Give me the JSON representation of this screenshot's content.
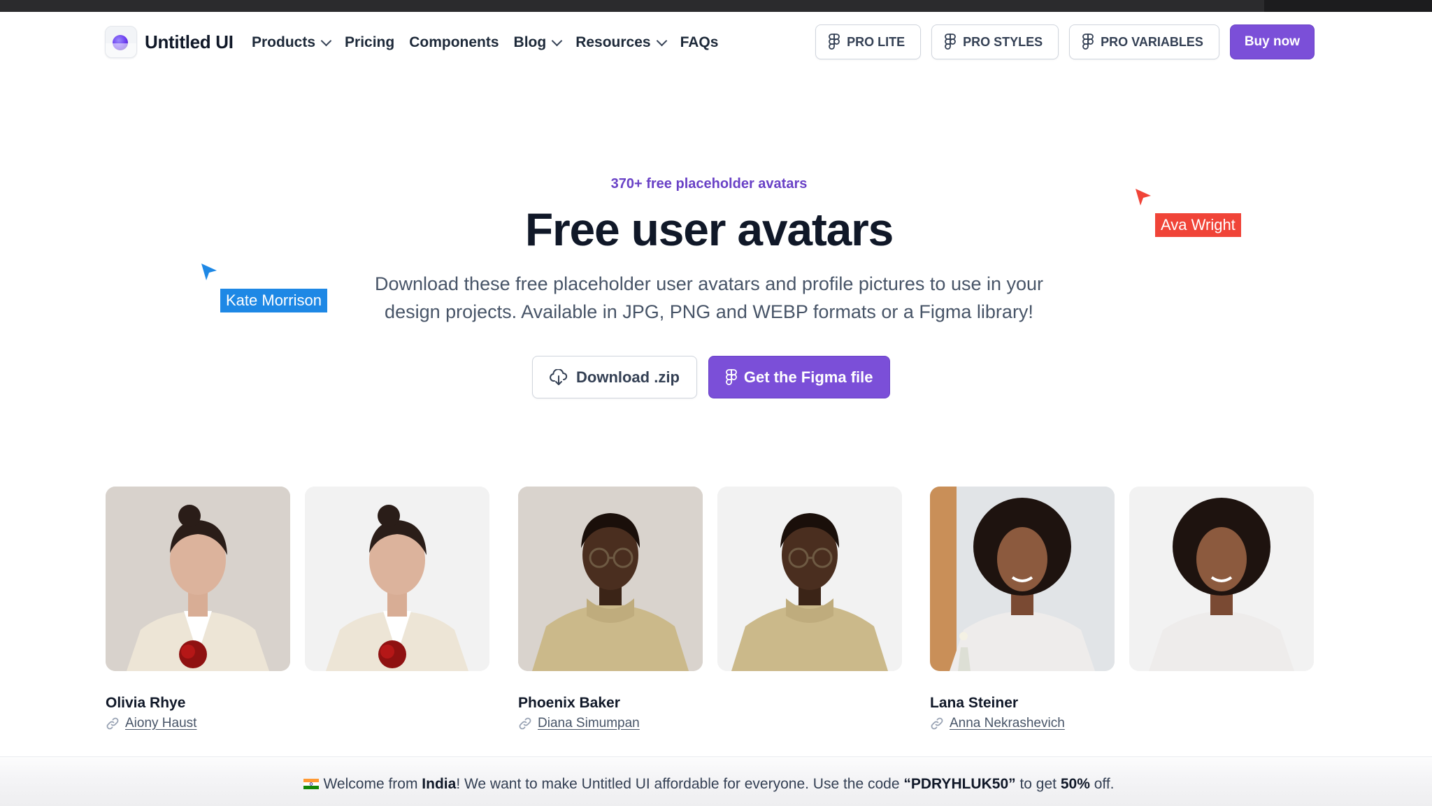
{
  "brand": {
    "name": "Untitled UI"
  },
  "nav": {
    "links": [
      {
        "label": "Products",
        "has_dropdown": true
      },
      {
        "label": "Pricing",
        "has_dropdown": false
      },
      {
        "label": "Components",
        "has_dropdown": false
      },
      {
        "label": "Blog",
        "has_dropdown": true
      },
      {
        "label": "Resources",
        "has_dropdown": true
      },
      {
        "label": "FAQs",
        "has_dropdown": false
      }
    ],
    "pro_lite": "PRO LITE",
    "pro_styles": "PRO STYLES",
    "pro_variables": "PRO VARIABLES",
    "buy_now": "Buy now"
  },
  "hero": {
    "eyebrow": "370+ free placeholder avatars",
    "title": "Free user avatars",
    "description_line1": "Download these free placeholder user avatars and profile pictures to use in your",
    "description_line2": "design projects. Available in JPG, PNG and WEBP formats or a Figma library!",
    "download_label": "Download .zip",
    "figma_label": "Get the Figma file"
  },
  "cursors": [
    {
      "name": "Kate Morrison",
      "color": "#1e88e5"
    },
    {
      "name": "Ava Wright",
      "color": "#f04438"
    }
  ],
  "people": [
    {
      "name": "Olivia Rhye",
      "credit": "Aiony Haust"
    },
    {
      "name": "Phoenix Baker",
      "credit": "Diana Simumpan"
    },
    {
      "name": "Lana Steiner",
      "credit": "Anna Nekrashevich"
    }
  ],
  "banner": {
    "prefix": "Welcome from ",
    "country": "India",
    "middle": "! We want to make Untitled UI affordable for everyone. Use the code ",
    "code": "“PDRYHLUK50”",
    "mid2": " to get ",
    "discount": "50%",
    "suffix": " off."
  },
  "colors": {
    "accent": "#7b4fd8",
    "eyebrow": "#6941c6"
  }
}
